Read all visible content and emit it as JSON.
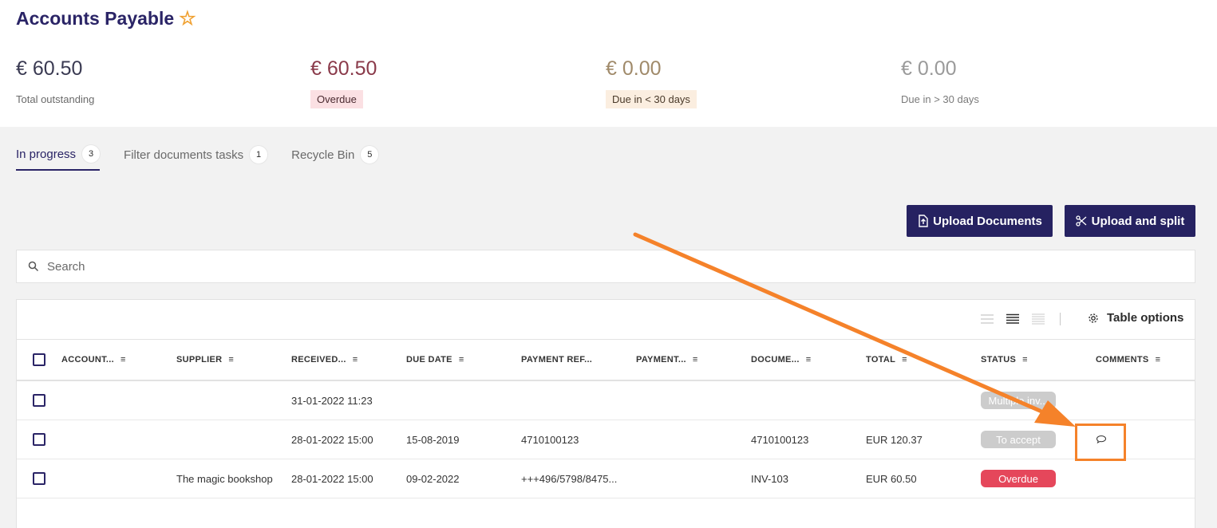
{
  "page": {
    "title": "Accounts Payable",
    "favorite_icon": "star-outline-icon",
    "accent_color": "#262261"
  },
  "kpis": [
    {
      "amount": "€ 60.50",
      "label": "Total outstanding"
    },
    {
      "amount": "€ 60.50",
      "label": "Overdue",
      "color": "#fbe0e3"
    },
    {
      "amount": "€ 0.00",
      "label": "Due in < 30 days",
      "color": "#fbeee0"
    },
    {
      "amount": "€ 0.00",
      "label": "Due in > 30 days"
    }
  ],
  "tabs": [
    {
      "label": "In progress",
      "count": "3",
      "active": true
    },
    {
      "label": "Filter documents tasks",
      "count": "1"
    },
    {
      "label": "Recycle Bin",
      "count": "5"
    }
  ],
  "actions": {
    "upload": "Upload Documents",
    "upload_split": "Upload and split"
  },
  "search": {
    "placeholder": "Search"
  },
  "table_toolbar": {
    "options_label": "Table options"
  },
  "columns": [
    "ACCOUNT...",
    "SUPPLIER",
    "RECEIVED...",
    "DUE DATE",
    "PAYMENT REF...",
    "PAYMENT...",
    "DOCUME...",
    "TOTAL",
    "STATUS",
    "COMMENTS"
  ],
  "rows": [
    {
      "account": "",
      "supplier": "",
      "received": "31-01-2022 11:23",
      "due": "",
      "pay_ref": "",
      "payment": "",
      "document": "",
      "total": "",
      "status": "Multiple inv...",
      "status_color": "#cccccc",
      "comment": ""
    },
    {
      "account": "",
      "supplier": "",
      "received": "28-01-2022 15:00",
      "due": "15-08-2019",
      "pay_ref": "4710100123",
      "payment": "",
      "document": "4710100123",
      "total": "EUR 120.37",
      "status": "To accept",
      "status_color": "#cccccc",
      "comment": "speech-bubble-icon"
    },
    {
      "account": "",
      "supplier": "The magic bookshop",
      "received": "28-01-2022 15:00",
      "due": "09-02-2022",
      "pay_ref": "+++496/5798/8475...",
      "payment": "",
      "document": "INV-103",
      "total": "EUR 60.50",
      "status": "Overdue",
      "status_color": "#e5475b",
      "comment": ""
    }
  ],
  "annotation": {
    "color": "#f5822a"
  }
}
